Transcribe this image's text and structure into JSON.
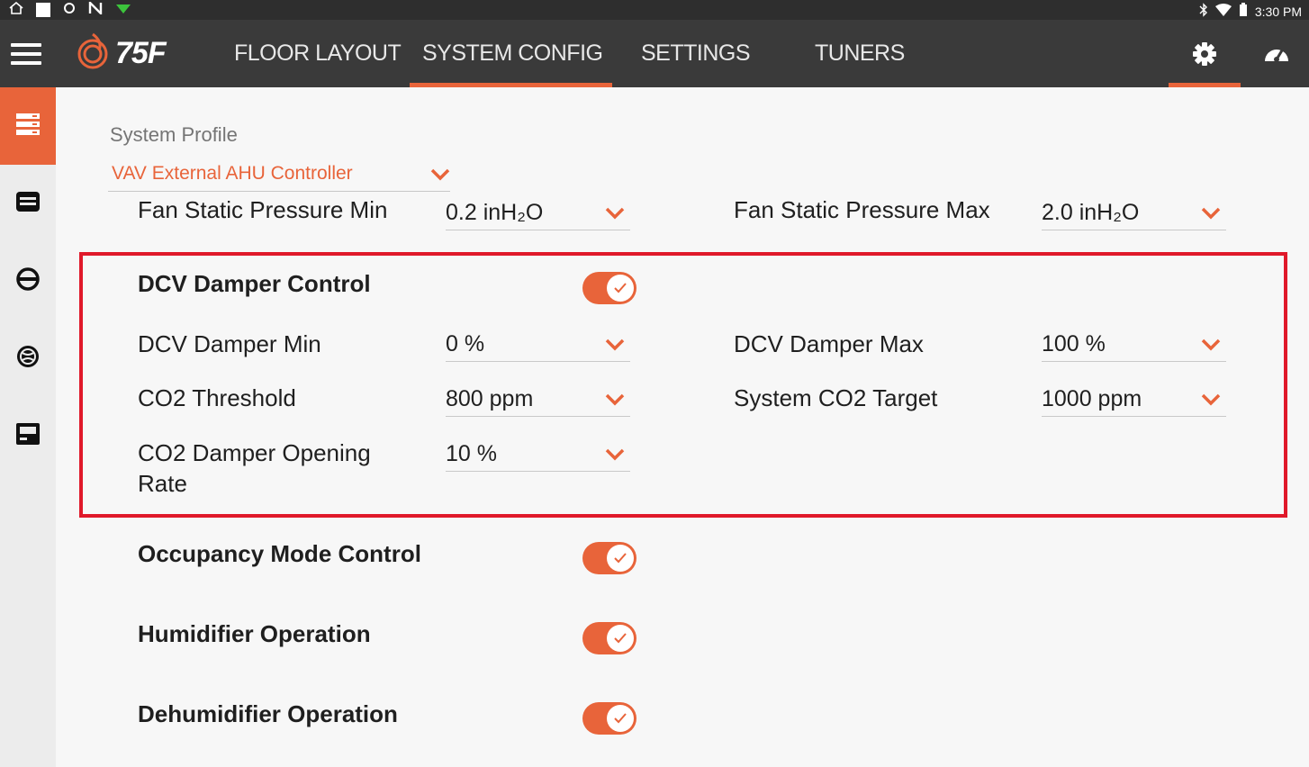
{
  "status_bar": {
    "time": "3:30 PM"
  },
  "app": {
    "logo": "75F",
    "nav_tabs": [
      {
        "label": "FLOOR LAYOUT",
        "active": false
      },
      {
        "label": "SYSTEM CONFIG",
        "active": true
      },
      {
        "label": "SETTINGS",
        "active": false
      },
      {
        "label": "TUNERS",
        "active": false
      }
    ]
  },
  "colors": {
    "accent": "#e8643a",
    "appbar": "#3a3a3a",
    "highlight": "#e0192a"
  },
  "system_profile": {
    "label": "System Profile",
    "value": "VAV External AHU Controller"
  },
  "fan_static": {
    "min_label": "Fan Static Pressure Min",
    "min_value": "0.2 inH₂O",
    "max_label": "Fan Static Pressure Max",
    "max_value": "2.0 inH₂O"
  },
  "dcv": {
    "control_label": "DCV Damper Control",
    "control_on": true,
    "min_label": "DCV Damper Min",
    "min_value": "0 %",
    "max_label": "DCV Damper Max",
    "max_value": "100 %",
    "threshold_label": "CO2 Threshold",
    "threshold_value": "800 ppm",
    "target_label": "System CO2 Target",
    "target_value": "1000 ppm",
    "opening_rate_label_1": "CO2 Damper Opening",
    "opening_rate_label_2": "Rate",
    "opening_rate_value": "10 %"
  },
  "toggles": {
    "occupancy_label": "Occupancy Mode Control",
    "occupancy_on": true,
    "humidifier_label": "Humidifier Operation",
    "humidifier_on": true,
    "dehumidifier_label": "Dehumidifier Operation",
    "dehumidifier_on": true
  }
}
